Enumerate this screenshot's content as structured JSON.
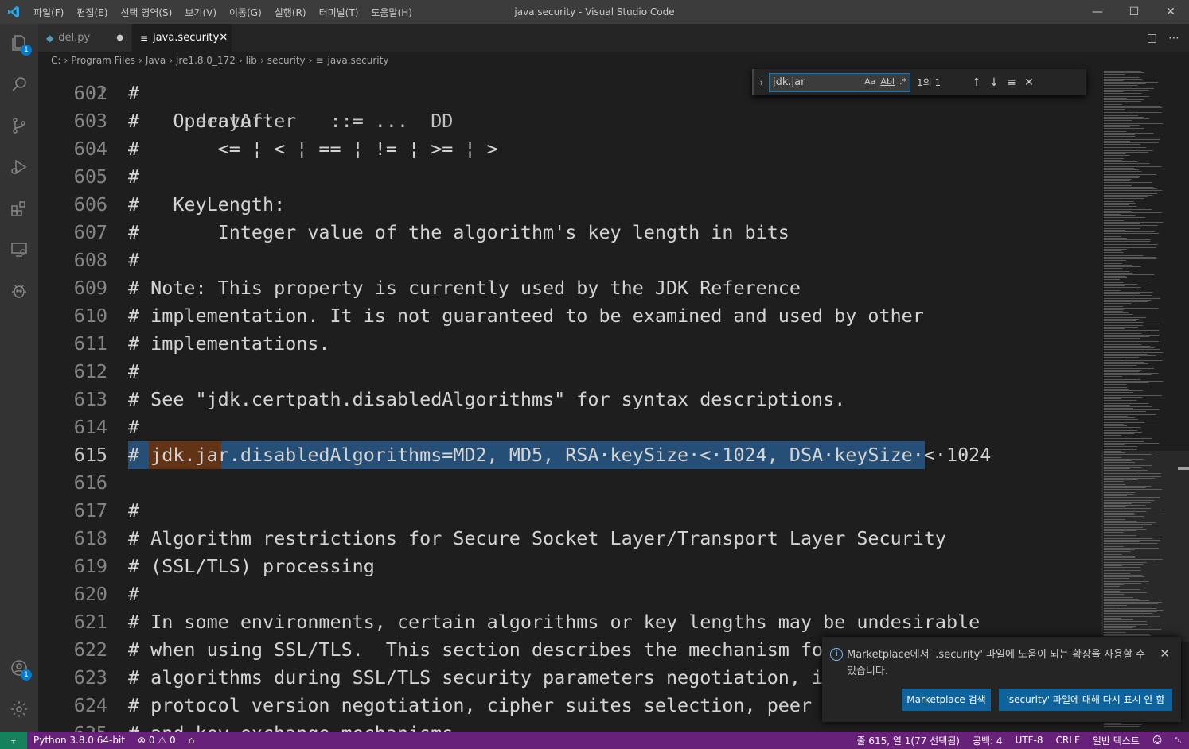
{
  "window": {
    "title": "java.security - Visual Studio Code",
    "menu": [
      "파일(F)",
      "편집(E)",
      "선택 영역(S)",
      "보기(V)",
      "이동(G)",
      "실행(R)",
      "터미널(T)",
      "도움말(H)"
    ]
  },
  "activity": {
    "explorer_badge": "1",
    "accounts_badge": "1"
  },
  "tabs": [
    {
      "label": "del.py",
      "dirty": true
    },
    {
      "label": "java.security",
      "active": true
    }
  ],
  "breadcrumb": [
    "C:",
    "Program Files",
    "Java",
    "jre1.8.0_172",
    "lib",
    "security",
    "java.security"
  ],
  "find": {
    "query": "jdk.jar",
    "opt_case": "Aa",
    "opt_word": "Abl",
    "opt_regex": ".*",
    "count": "1의 1"
  },
  "editor": {
    "partial_top": "#     denyAfter   ::= ...  DD",
    "lines": [
      {
        "n": "602",
        "text": "#"
      },
      {
        "n": "603",
        "text": "#   Operator:"
      },
      {
        "n": "604",
        "text": "#       <= ¦ < ¦ == ¦ != ¦ >= ¦ >"
      },
      {
        "n": "605",
        "text": "#"
      },
      {
        "n": "606",
        "text": "#   KeyLength:"
      },
      {
        "n": "607",
        "text": "#       Integer value of the algorithm's key length in bits"
      },
      {
        "n": "608",
        "text": "#"
      },
      {
        "n": "609",
        "text": "# Note: This property is currently used by the JDK Reference"
      },
      {
        "n": "610",
        "text": "# implementation. It is not guaranteed to be examined and used by other"
      },
      {
        "n": "611",
        "text": "# implementations."
      },
      {
        "n": "612",
        "text": "#"
      },
      {
        "n": "613",
        "text": "# See \"jdk.certpath.disabledAlgorithms\" for syntax descriptions."
      },
      {
        "n": "614",
        "text": "#"
      },
      {
        "n": "615",
        "text": "# jdk.jar.disabledAlgorithms=MD2, MD5, RSA·keySize·<·1024, DSA·keySize·<·1024"
      },
      {
        "n": "616",
        "text": ""
      },
      {
        "n": "617",
        "text": "#"
      },
      {
        "n": "618",
        "text": "# Algorithm restrictions for Secure Socket Layer/Transport Layer Security"
      },
      {
        "n": "619",
        "text": "# (SSL/TLS) processing"
      },
      {
        "n": "620",
        "text": "#"
      },
      {
        "n": "621",
        "text": "# In some environments, certain algorithms or key lengths may be undesirable"
      },
      {
        "n": "622",
        "text": "# when using SSL/TLS.  This section describes the mechanism for dis"
      },
      {
        "n": "623",
        "text": "# algorithms during SSL/TLS security parameters negotiation, includ"
      },
      {
        "n": "624",
        "text": "# protocol version negotiation, cipher suites selection, peer authe"
      },
      {
        "n": "625",
        "text": "# and key exchange mechanisms."
      }
    ]
  },
  "notification": {
    "message": "Marketplace에서 '.security' 파일에 도움이 되는 확장을 사용할 수 있습니다.",
    "button_search": "Marketplace 검색",
    "button_dismiss": "'security' 파일에 대해 다시 표시 안 함"
  },
  "status": {
    "python": "Python 3.8.0 64-bit",
    "errors": "0",
    "warnings": "0",
    "position": "줄 615, 열 1(77 선택됨)",
    "spaces": "공백: 4",
    "encoding": "UTF-8",
    "eol": "CRLF",
    "language": "일반 텍스트"
  },
  "colors": {
    "accent": "#007acc",
    "statusbar": "#68217a",
    "remote": "#16825d",
    "selection": "#264f78",
    "find_match": "#623315"
  }
}
